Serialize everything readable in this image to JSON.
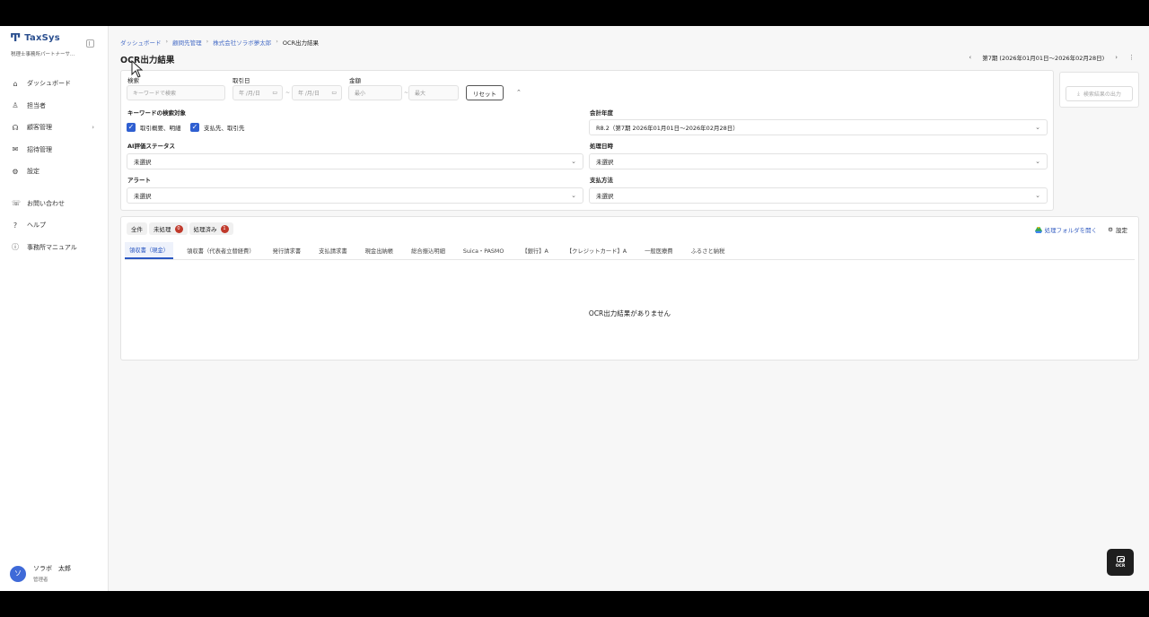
{
  "brand": {
    "logo": "Ͳ",
    "name": "TaxSys",
    "org": "税理士事務所パートナーサ…"
  },
  "sidebar": {
    "items": [
      {
        "label": "ダッシュボード",
        "icon": "home-icon",
        "glyph": "⌂"
      },
      {
        "label": "担当者",
        "icon": "person-icon",
        "glyph": "♙"
      },
      {
        "label": "顧客管理",
        "icon": "headset-icon",
        "glyph": "☊",
        "chevron": "›"
      },
      {
        "label": "招待管理",
        "icon": "mail-icon",
        "glyph": "✉"
      },
      {
        "label": "設定",
        "icon": "gear-icon",
        "glyph": "⚙"
      }
    ],
    "support": [
      {
        "label": "お問い合わせ",
        "icon": "chat-icon",
        "glyph": "☏"
      },
      {
        "label": "ヘルプ",
        "icon": "help-icon",
        "glyph": "?"
      },
      {
        "label": "事務所マニュアル",
        "icon": "info-icon",
        "glyph": "ⓘ"
      }
    ]
  },
  "user": {
    "initial": "ソ",
    "name": "ソラボ　太郎",
    "role": "管理者"
  },
  "breadcrumb": [
    "ダッシュボード",
    "顧問先管理",
    "株式会社ソラボ夢太郎",
    "OCR出力結果"
  ],
  "page_title": "OCR出力結果",
  "period": {
    "prev": "‹",
    "label": "第7期 (2026年01月01日〜2026年02月28日)",
    "next": "›",
    "more": "⋮"
  },
  "filters": {
    "search_label": "検索",
    "search_placeholder": "キーワードで検索",
    "date_label": "取引日",
    "date_placeholder": "年 /月/日",
    "amount_label": "金額",
    "amount_min": "最小",
    "amount_max": "最大",
    "reset": "リセット",
    "keyword_target_label": "キーワードの検索対象",
    "keyword_opt1": "取引概要、明細",
    "keyword_opt2": "支払先、取引先",
    "fiscal_year_label": "会計年度",
    "fiscal_year_value": "R8.2（第7期 2026年01月01日〜2026年02月28日）",
    "ai_status_label": "AI評価ステータス",
    "ai_status_value": "未選択",
    "processed_at_label": "処理日時",
    "processed_at_value": "未選択",
    "alert_label": "アラート",
    "alert_value": "未選択",
    "payment_label": "支払方法",
    "payment_value": "未選択"
  },
  "export": {
    "label": "検索結果の出力"
  },
  "results": {
    "status_tabs": [
      {
        "label": "全件"
      },
      {
        "label": "未処理",
        "badge": "0"
      },
      {
        "label": "処理済み",
        "badge": "1"
      }
    ],
    "open_folder": "処理フォルダを開く",
    "settings": "設定",
    "doc_tabs": [
      "領収書（現金）",
      "領収書（代表者立替経費）",
      "発行請求書",
      "支払請求書",
      "現金出納帳",
      "総合振込明細",
      "Suica・PASMO",
      "【銀行】A",
      "【クレジットカード】A",
      "一般医療費",
      "ふるさと納税"
    ],
    "empty": "OCR出力結果がありません"
  },
  "fab": {
    "label": "OCR"
  },
  "colors": {
    "accent": "#2f5fd1",
    "badge_red": "#c0392b",
    "badge_gray": "#999999"
  }
}
